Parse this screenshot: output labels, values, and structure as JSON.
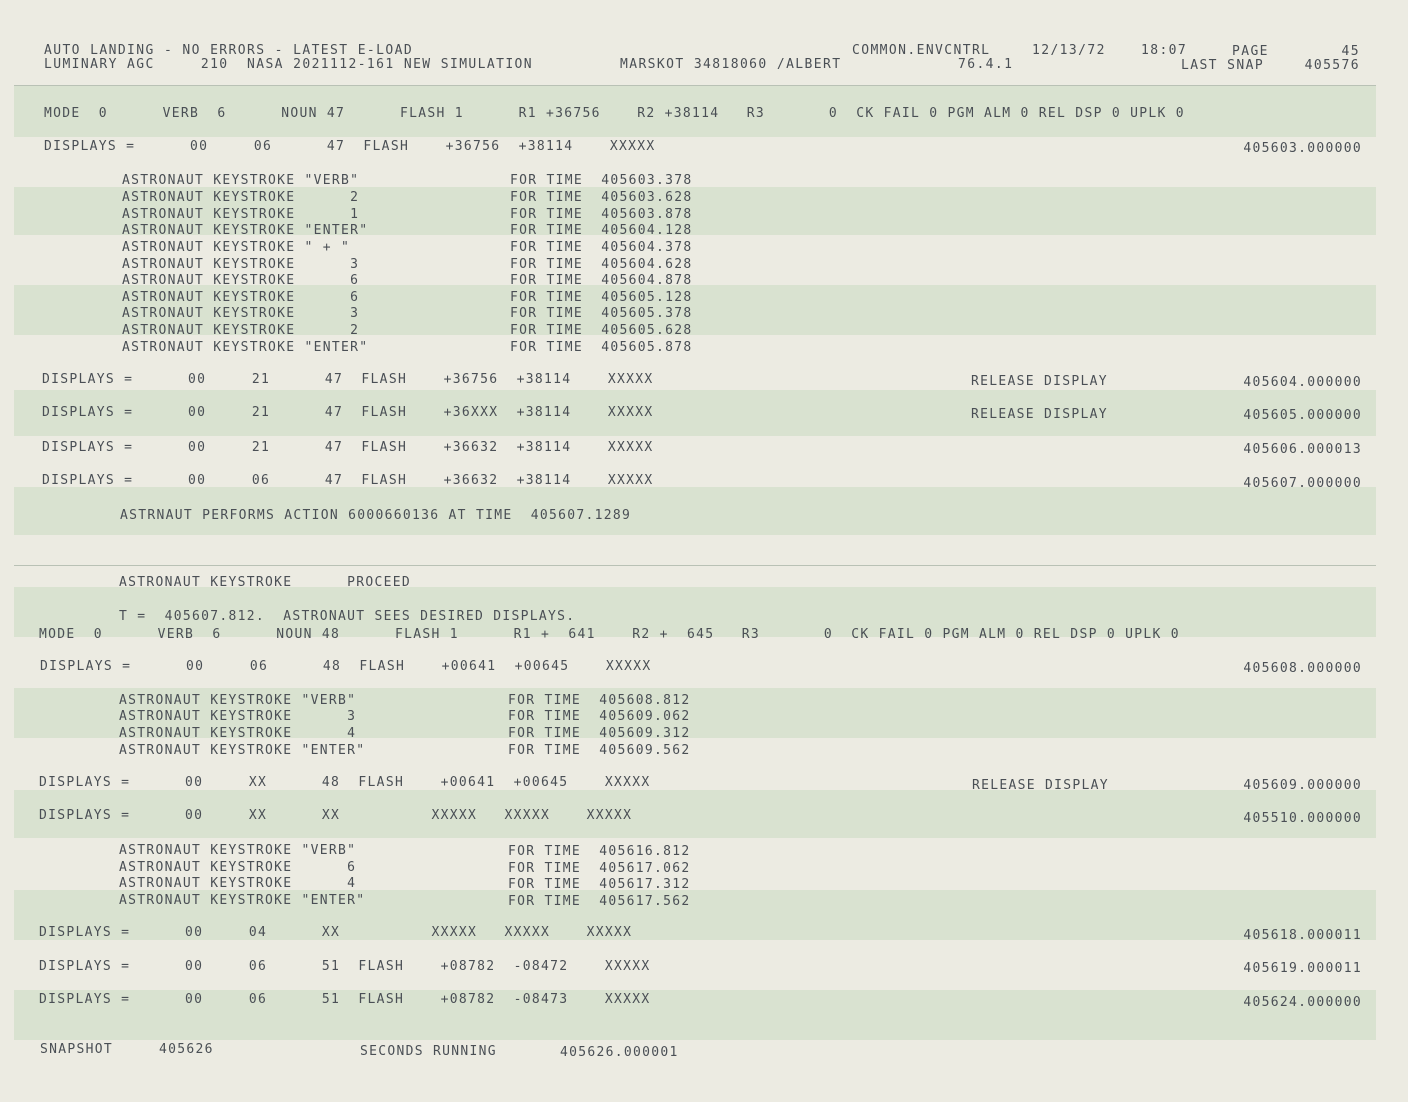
{
  "header": {
    "line1_left": "AUTO LANDING - NO ERRORS - LATEST E-LOAD",
    "line1_mid": "COMMON.ENVCNTRL",
    "line1_date": "12/13/72",
    "line1_time": "18:07",
    "page_label": "PAGE",
    "page_number": "45",
    "line2_left": "LUMINARY AGC     210  NASA 2021112-161 NEW SIMULATION",
    "line2_mid": "MARSKOT 34818060 /ALBERT",
    "line2_ver": "76.4.1",
    "snap_label": "LAST SNAP",
    "snap_value": "405576"
  },
  "status1": "MODE  0      VERB  6      NOUN 47      FLASH 1      R1 +36756    R2 +38114   R3       0  CK FAIL 0 PGM ALM 0 REL DSP 0 UPLK 0",
  "display1": "DISPLAYS =      00     06      47  FLASH    +36756  +38114    XXXXX",
  "display1_time": "405603.000000",
  "keystrokes1": [
    {
      "action": "ASTRONAUT KEYSTROKE \"VERB\"",
      "time": "FOR TIME  405603.378"
    },
    {
      "action": "ASTRONAUT KEYSTROKE      2",
      "time": "FOR TIME  405603.628"
    },
    {
      "action": "ASTRONAUT KEYSTROKE      1",
      "time": "FOR TIME  405603.878"
    },
    {
      "action": "ASTRONAUT KEYSTROKE \"ENTER\"",
      "time": "FOR TIME  405604.128"
    },
    {
      "action": "ASTRONAUT KEYSTROKE \" + \"",
      "time": "FOR TIME  405604.378"
    },
    {
      "action": "ASTRONAUT KEYSTROKE      3",
      "time": "FOR TIME  405604.628"
    },
    {
      "action": "ASTRONAUT KEYSTROKE      6",
      "time": "FOR TIME  405604.878"
    },
    {
      "action": "ASTRONAUT KEYSTROKE      6",
      "time": "FOR TIME  405605.128"
    },
    {
      "action": "ASTRONAUT KEYSTROKE      3",
      "time": "FOR TIME  405605.378"
    },
    {
      "action": "ASTRONAUT KEYSTROKE      2",
      "time": "FOR TIME  405605.628"
    },
    {
      "action": "ASTRONAUT KEYSTROKE \"ENTER\"",
      "time": "FOR TIME  405605.878"
    }
  ],
  "displays2": [
    {
      "text": "DISPLAYS =      00     21      47  FLASH    +36756  +38114    XXXXX",
      "note": "RELEASE DISPLAY",
      "time": "405604.000000"
    },
    {
      "text": "DISPLAYS =      00     21      47  FLASH    +36XXX  +38114    XXXXX",
      "note": "RELEASE DISPLAY",
      "time": "405605.000000"
    },
    {
      "text": "DISPLAYS =      00     21      47  FLASH    +36632  +38114    XXXXX",
      "note": "",
      "time": "405606.000013"
    },
    {
      "text": "DISPLAYS =      00     06      47  FLASH    +36632  +38114    XXXXX",
      "note": "",
      "time": "405607.000000"
    }
  ],
  "action_line": "ASTRNAUT PERFORMS ACTION 6000660136 AT TIME  405607.1289",
  "proceed_line": "ASTRONAUT KEYSTROKE      PROCEED",
  "sees_line": "T =  405607.812.  ASTRONAUT SEES DESIRED DISPLAYS.",
  "status2": "MODE  0      VERB  6      NOUN 48      FLASH 1      R1 +  641    R2 +  645   R3       0  CK FAIL 0 PGM ALM 0 REL DSP 0 UPLK 0",
  "display3": "DISPLAYS =      00     06      48  FLASH    +00641  +00645    XXXXX",
  "display3_time": "405608.000000",
  "keystrokes2": [
    {
      "action": "ASTRONAUT KEYSTROKE \"VERB\"",
      "time": "FOR TIME  405608.812"
    },
    {
      "action": "ASTRONAUT KEYSTROKE      3",
      "time": "FOR TIME  405609.062"
    },
    {
      "action": "ASTRONAUT KEYSTROKE      4",
      "time": "FOR TIME  405609.312"
    },
    {
      "action": "ASTRONAUT KEYSTROKE \"ENTER\"",
      "time": "FOR TIME  405609.562"
    }
  ],
  "display4": {
    "text": "DISPLAYS =      00     XX      48  FLASH    +00641  +00645    XXXXX",
    "note": "RELEASE DISPLAY",
    "time": "405609.000000"
  },
  "display5": {
    "text": "DISPLAYS =      00     XX      XX          XXXXX   XXXXX    XXXXX",
    "time": "405510.000000"
  },
  "keystrokes3": [
    {
      "action": "ASTRONAUT KEYSTROKE \"VERB\"",
      "time": "FOR TIME  405616.812"
    },
    {
      "action": "ASTRONAUT KEYSTROKE      6",
      "time": "FOR TIME  405617.062"
    },
    {
      "action": "ASTRONAUT KEYSTROKE      4",
      "time": "FOR TIME  405617.312"
    },
    {
      "action": "ASTRONAUT KEYSTROKE \"ENTER\"",
      "time": "FOR TIME  405617.562"
    }
  ],
  "displays6": [
    {
      "text": "DISPLAYS =      00     04      XX          XXXXX   XXXXX    XXXXX",
      "time": "405618.000011"
    },
    {
      "text": "DISPLAYS =      00     06      51  FLASH    +08782  -08472    XXXXX",
      "time": "405619.000011"
    },
    {
      "text": "DISPLAYS =      00     06      51  FLASH    +08782  -08473    XXXXX",
      "time": "405624.000000"
    }
  ],
  "snapshot": {
    "label": "SNAPSHOT",
    "value": "405626",
    "running_label": "SECONDS RUNNING",
    "running_value": "405626.000001"
  }
}
